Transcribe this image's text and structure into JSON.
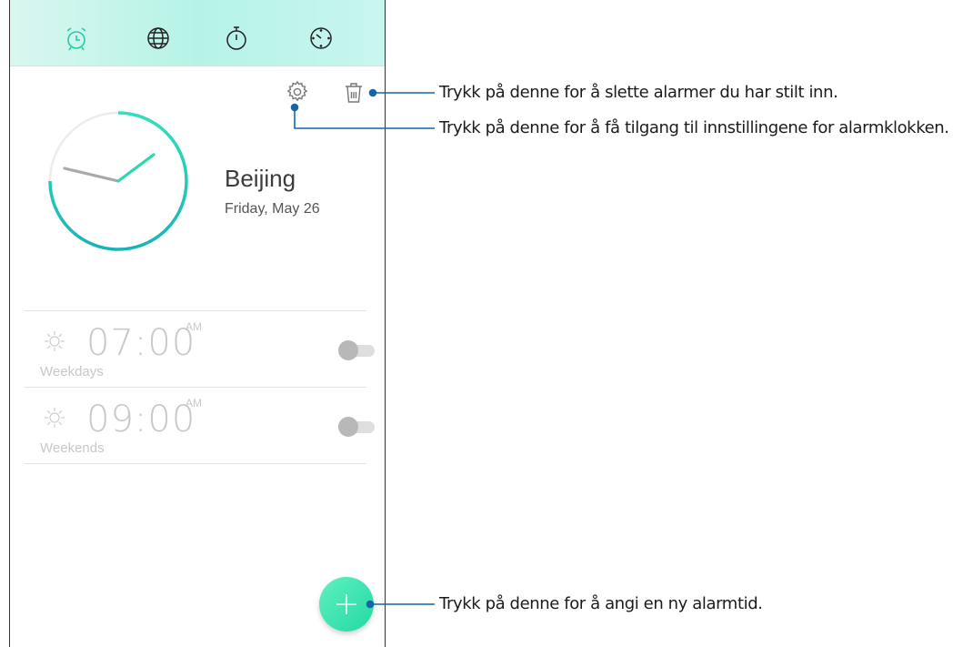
{
  "tabs": [
    {
      "name": "alarm-icon",
      "active": true
    },
    {
      "name": "globe-icon",
      "active": false
    },
    {
      "name": "stopwatch-icon",
      "active": false
    },
    {
      "name": "timer-icon",
      "active": false
    }
  ],
  "header_actions": {
    "settings_icon": "gear-icon",
    "delete_icon": "trash-icon"
  },
  "world_clock": {
    "city": "Beijing",
    "date": "Friday, May 26"
  },
  "alarms": [
    {
      "time": "07:00",
      "ampm": "AM",
      "repeat": "Weekdays",
      "enabled": false
    },
    {
      "time": "09:00",
      "ampm": "AM",
      "repeat": "Weekends",
      "enabled": false
    }
  ],
  "fab": {
    "icon": "plus-icon"
  },
  "annotations": {
    "delete": "Trykk på denne for å slette alarmer du har stilt inn.",
    "settings": "Trykk på denne for å få tilgang til innstillingene for alarmklokken.",
    "add": "Trykk på denne for å angi en ny alarmtid."
  },
  "colors": {
    "accent": "#22d3b0",
    "callout": "#1565a8",
    "topbar": "#c2f3e8"
  }
}
